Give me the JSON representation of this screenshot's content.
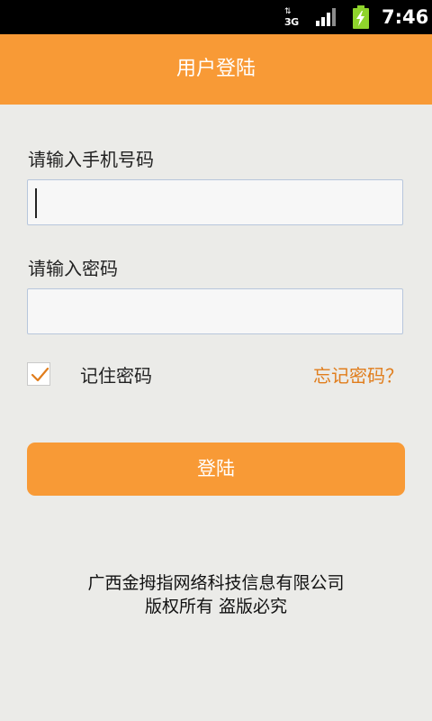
{
  "status_bar": {
    "network_label": "3G",
    "network_arrows": "⇅",
    "time": "7:46",
    "battery_color": "#8fd42c"
  },
  "app_bar": {
    "title": "用户登陆",
    "color": "#f89a36"
  },
  "form": {
    "phone_label": "请输入手机号码",
    "phone_value": "",
    "password_label": "请输入密码",
    "password_value": "",
    "remember_checked": true,
    "remember_label": "记住密码",
    "forgot_link": "忘记密码？",
    "login_button": "登陆"
  },
  "footer": {
    "line1": "广西金拇指网络科技信息有限公司",
    "line2": "版权所有 盗版必究"
  }
}
